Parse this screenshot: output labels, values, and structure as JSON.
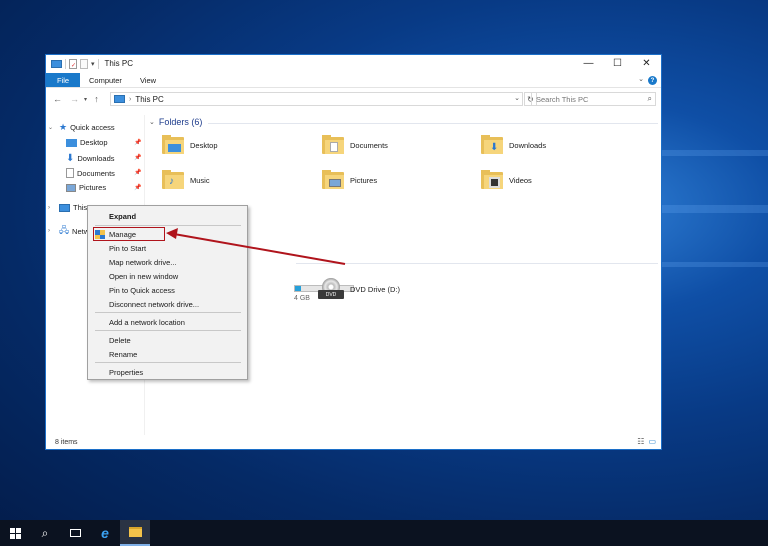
{
  "window": {
    "title": "This PC",
    "minimize": "—",
    "maximize": "☐",
    "close": "✕"
  },
  "ribbon": {
    "file_tab": "File",
    "tabs": [
      "Computer",
      "View"
    ],
    "help": "?"
  },
  "nav": {
    "back": "←",
    "forward": "→",
    "up": "↑",
    "address": "This PC",
    "search_placeholder": "Search This PC"
  },
  "navpane": {
    "quick_access": "Quick access",
    "items": [
      "Desktop",
      "Downloads",
      "Documents",
      "Pictures"
    ],
    "this_pc": "This PC",
    "network": "Network"
  },
  "content": {
    "folders_heading": "Folders (6)",
    "folders": [
      "Desktop",
      "Documents",
      "Downloads",
      "Music",
      "Pictures",
      "Videos"
    ],
    "drive_size_fragment": "4 GB",
    "drive_fill_percent": 10,
    "dvd_label": "DVD Drive (D:)",
    "dvd_badge": "DVD"
  },
  "status": {
    "item_count": "8 items"
  },
  "context_menu": {
    "items": [
      "Expand",
      "Manage",
      "Pin to Start",
      "Map network drive...",
      "Open in new window",
      "Pin to Quick access",
      "Disconnect network drive...",
      "Add a network location",
      "Delete",
      "Rename",
      "Properties"
    ]
  },
  "colors": {
    "accent": "#1979ca",
    "highlight_box": "#b0141c",
    "annotation_arrow": "#b0141c"
  }
}
